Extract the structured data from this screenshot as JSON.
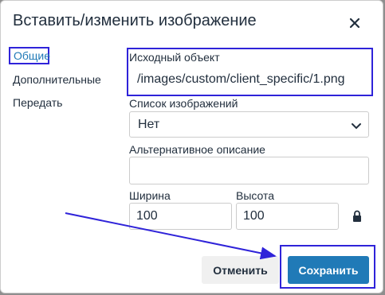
{
  "dialog": {
    "title": "Вставить/изменить изображение",
    "close_icon": "close-icon"
  },
  "nav": {
    "items": [
      {
        "label": "Общие",
        "active": true
      },
      {
        "label": "Дополнительные",
        "active": false
      },
      {
        "label": "Передать",
        "active": false
      }
    ]
  },
  "form": {
    "source": {
      "label": "Исходный объект",
      "value": "/images/custom/client_specific/1.png"
    },
    "image_list": {
      "label": "Список изображений",
      "selected": "Нет"
    },
    "alt": {
      "label": "Альтернативное описание",
      "value": ""
    },
    "width": {
      "label": "Ширина",
      "value": "100"
    },
    "height": {
      "label": "Высота",
      "value": "100"
    },
    "lock_icon": "lock-icon"
  },
  "buttons": {
    "cancel": "Отменить",
    "save": "Сохранить"
  },
  "colors": {
    "accent": "#207ab7",
    "highlight": "#2f23d9",
    "text": "#222f3e"
  }
}
